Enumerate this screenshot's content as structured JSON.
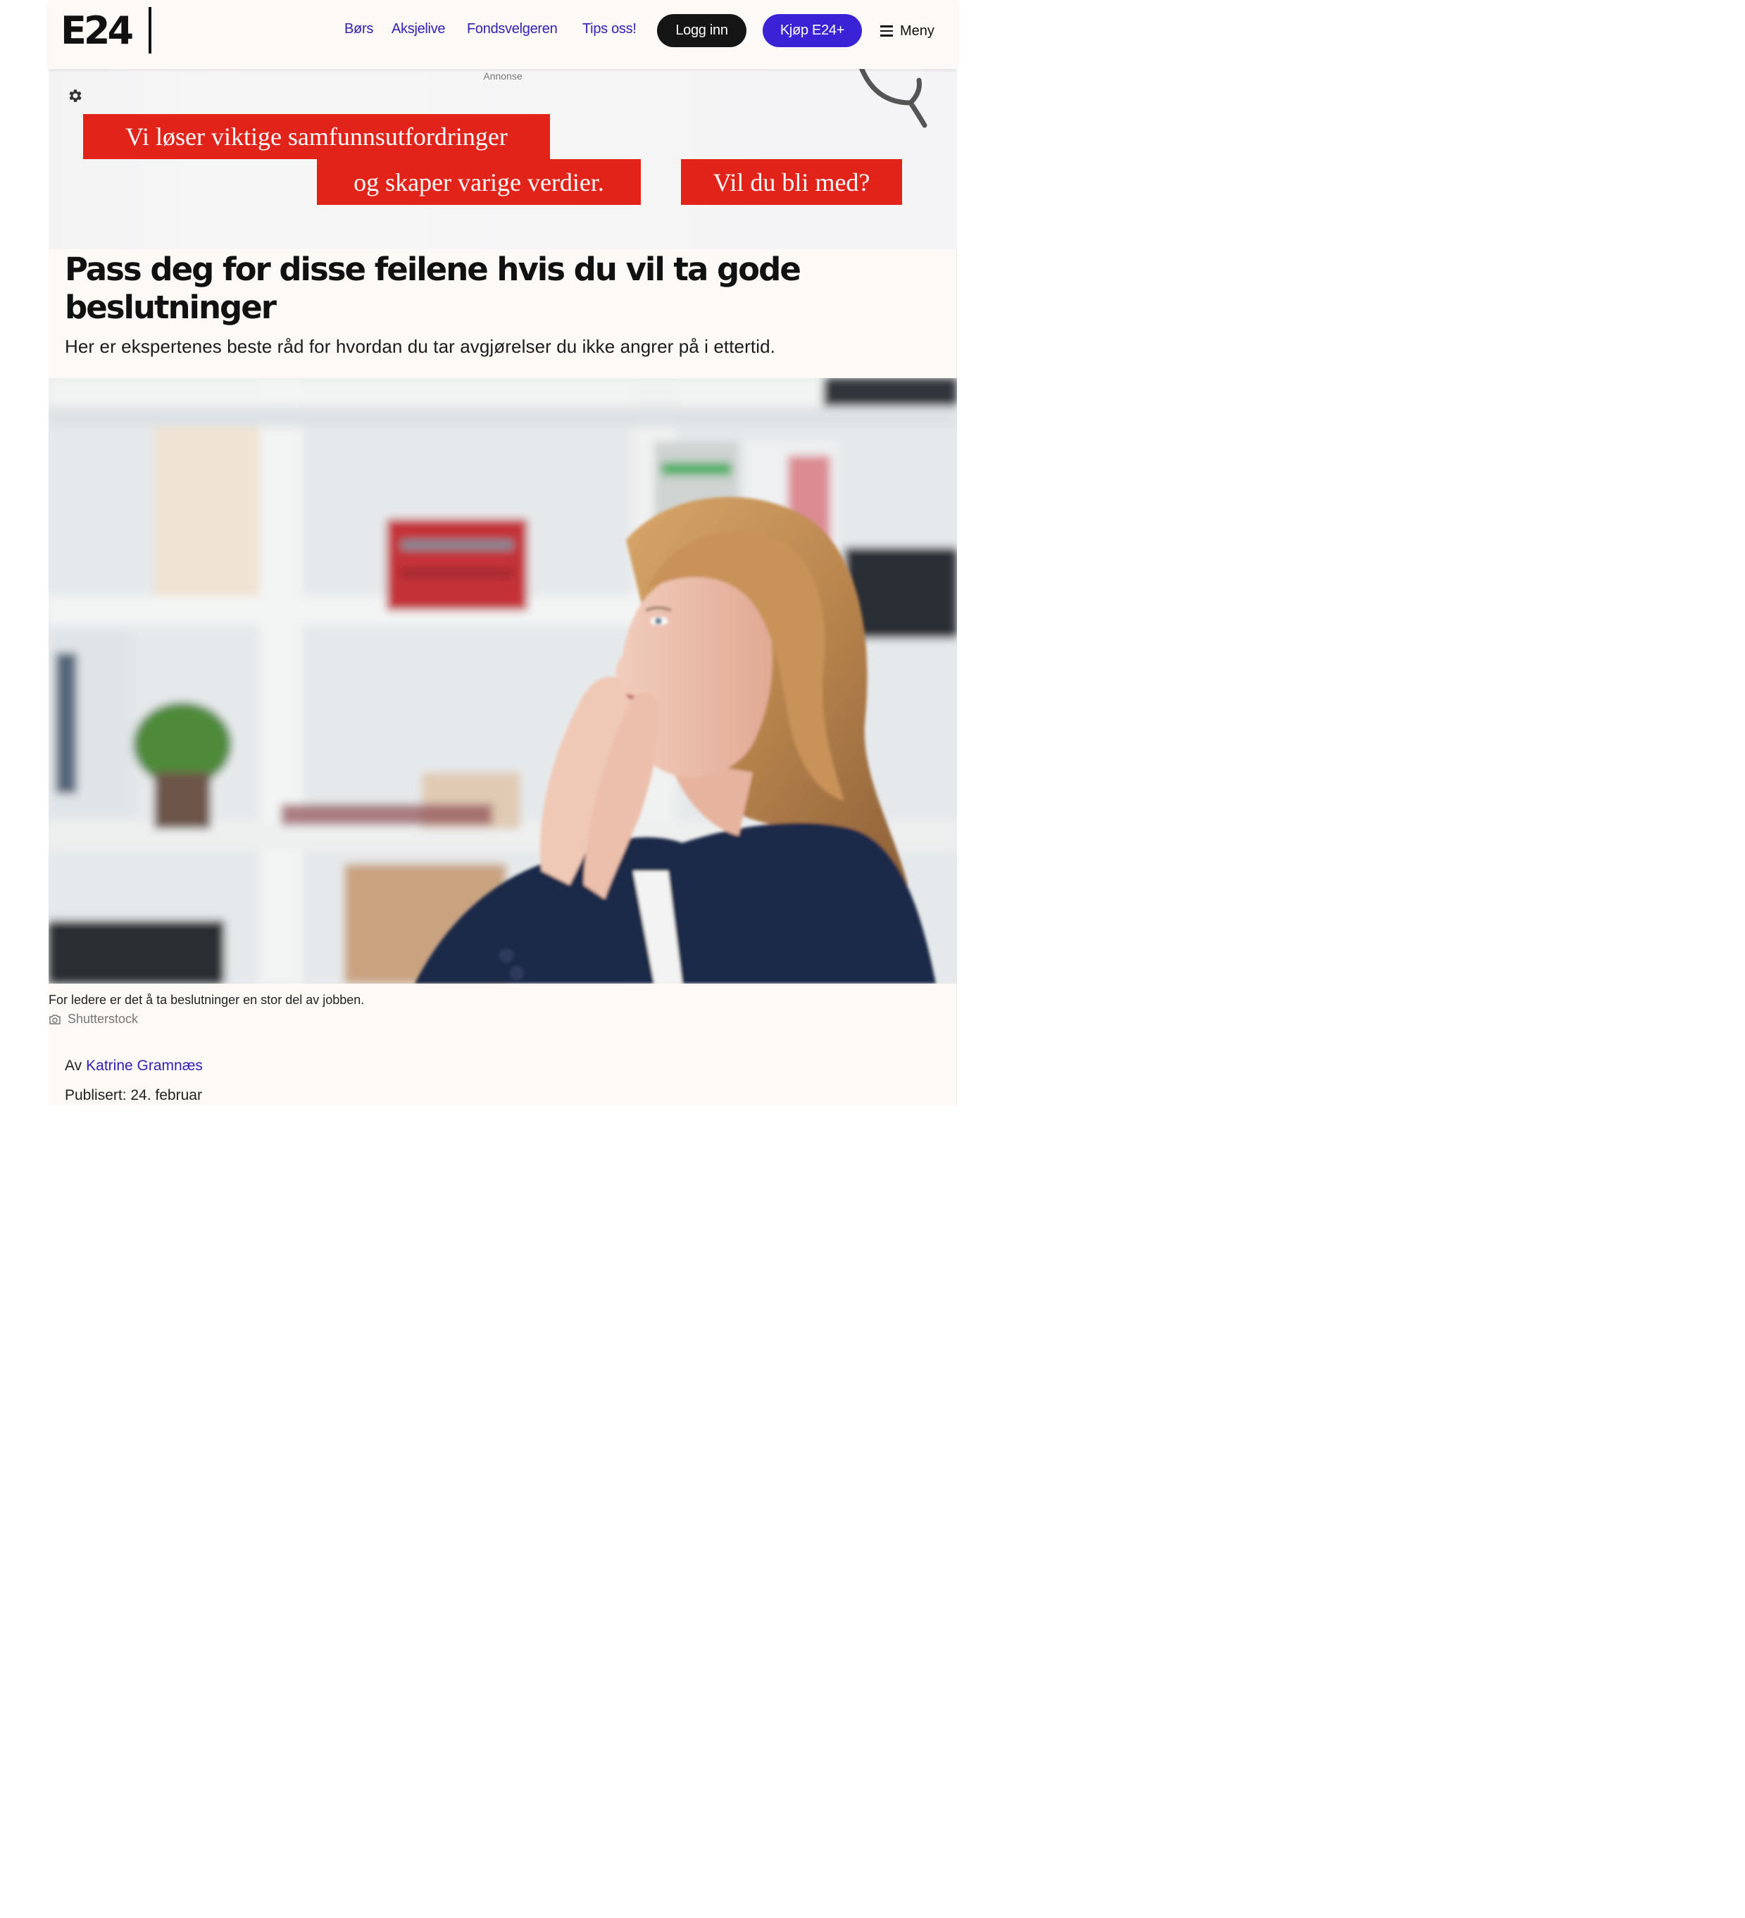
{
  "header": {
    "logo": "E24",
    "nav": [
      "Børs",
      "Aksjelive",
      "Fondsvelgeren",
      "Tips oss!"
    ],
    "login_label": "Logg inn",
    "buy_label": "Kjøp E24+",
    "menu_label": "Meny"
  },
  "ad": {
    "label": "Annonse",
    "line1": "Vi løser viktige samfunnsutfordringer",
    "line2": "og skaper varige verdier.",
    "line3": "Vil du bli med?",
    "accent": "#e2231a"
  },
  "article": {
    "headline": "Pass deg for disse feilene hvis du vil ta gode beslutninger",
    "lead": "Her er ekspertenes beste råd for hvordan du tar avgjørelser du ikke angrer på i ettertid.",
    "caption": "For ledere er det å ta beslutninger en stor del av jobben.",
    "credit": "Shutterstock",
    "byline_prefix": "Av",
    "author": "Katrine Gramnæs",
    "published": "Publisert: 24. februar"
  },
  "colors": {
    "brand": "#3a22d6",
    "link": "#3320b5",
    "background": "#fdf9f6"
  }
}
